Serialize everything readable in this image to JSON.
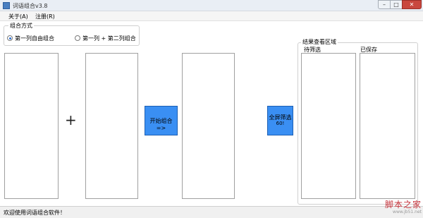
{
  "window": {
    "title": "词语组合v3.8",
    "minimize": "–",
    "maximize": "□",
    "close": "✕"
  },
  "menu": {
    "about": "关于(A)",
    "register": "注册(R)"
  },
  "combo_mode": {
    "label": "组合方式",
    "option1": "第一列自由组合",
    "option2": "第一列 + 第二列组合",
    "selected": 1
  },
  "plus_sign": "+",
  "buttons": {
    "combine": "开始组合=>",
    "filter": "全屏筛选",
    "filter_sub": "60!"
  },
  "results": {
    "label": "结果查看区域",
    "pending": "待筛选",
    "saved": "已保存"
  },
  "status": {
    "text": "欢迎使用词语组合软件！"
  },
  "watermark": {
    "main": "脚本之家",
    "url": "www.jb51.net"
  }
}
